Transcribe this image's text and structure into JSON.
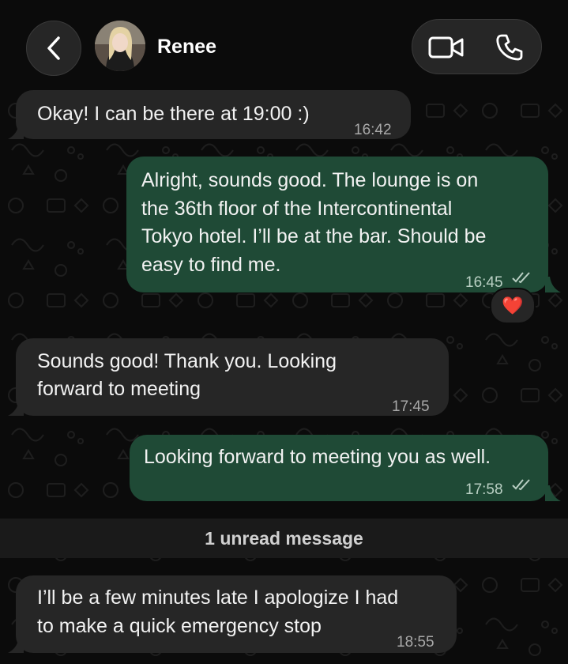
{
  "header": {
    "contact_name": "Renee",
    "back_icon": "chevron-left-icon",
    "video_icon": "video-camera-icon",
    "phone_icon": "phone-icon"
  },
  "messages": [
    {
      "direction": "incoming",
      "text": "Okay! I can be there at 19:00 :)",
      "time": "16:42"
    },
    {
      "direction": "outgoing",
      "text": "Alright, sounds good. The lounge is on the 36th floor of the Intercontinental Tokyo hotel. I’ll be at the bar. Should be easy to find me.",
      "lines": [
        "Alright, sounds good. The lounge is on",
        "the 36th floor of the Intercontinental",
        "Tokyo hotel. I’ll be at the bar. Should be",
        "easy to find me."
      ],
      "time": "16:45",
      "status": "read",
      "reaction": "❤️"
    },
    {
      "direction": "incoming",
      "text": "Sounds good! Thank you. Looking forward to meeting",
      "lines": [
        "Sounds good! Thank you. Looking",
        "forward to meeting"
      ],
      "time": "17:45"
    },
    {
      "direction": "outgoing",
      "text": "Looking forward to meeting you as well.",
      "time": "17:58",
      "status": "read"
    },
    {
      "direction": "incoming",
      "text": "I’ll be a few minutes late I apologize I had to make a quick emergency stop",
      "lines": [
        "I’ll be a few minutes late I apologize I had",
        "to make a quick emergency stop"
      ],
      "time": "18:55"
    }
  ],
  "unread_label": "1 unread message",
  "colors": {
    "incoming_bubble": "#262626",
    "outgoing_bubble": "#1f4a36",
    "background": "#0b0b0b"
  }
}
